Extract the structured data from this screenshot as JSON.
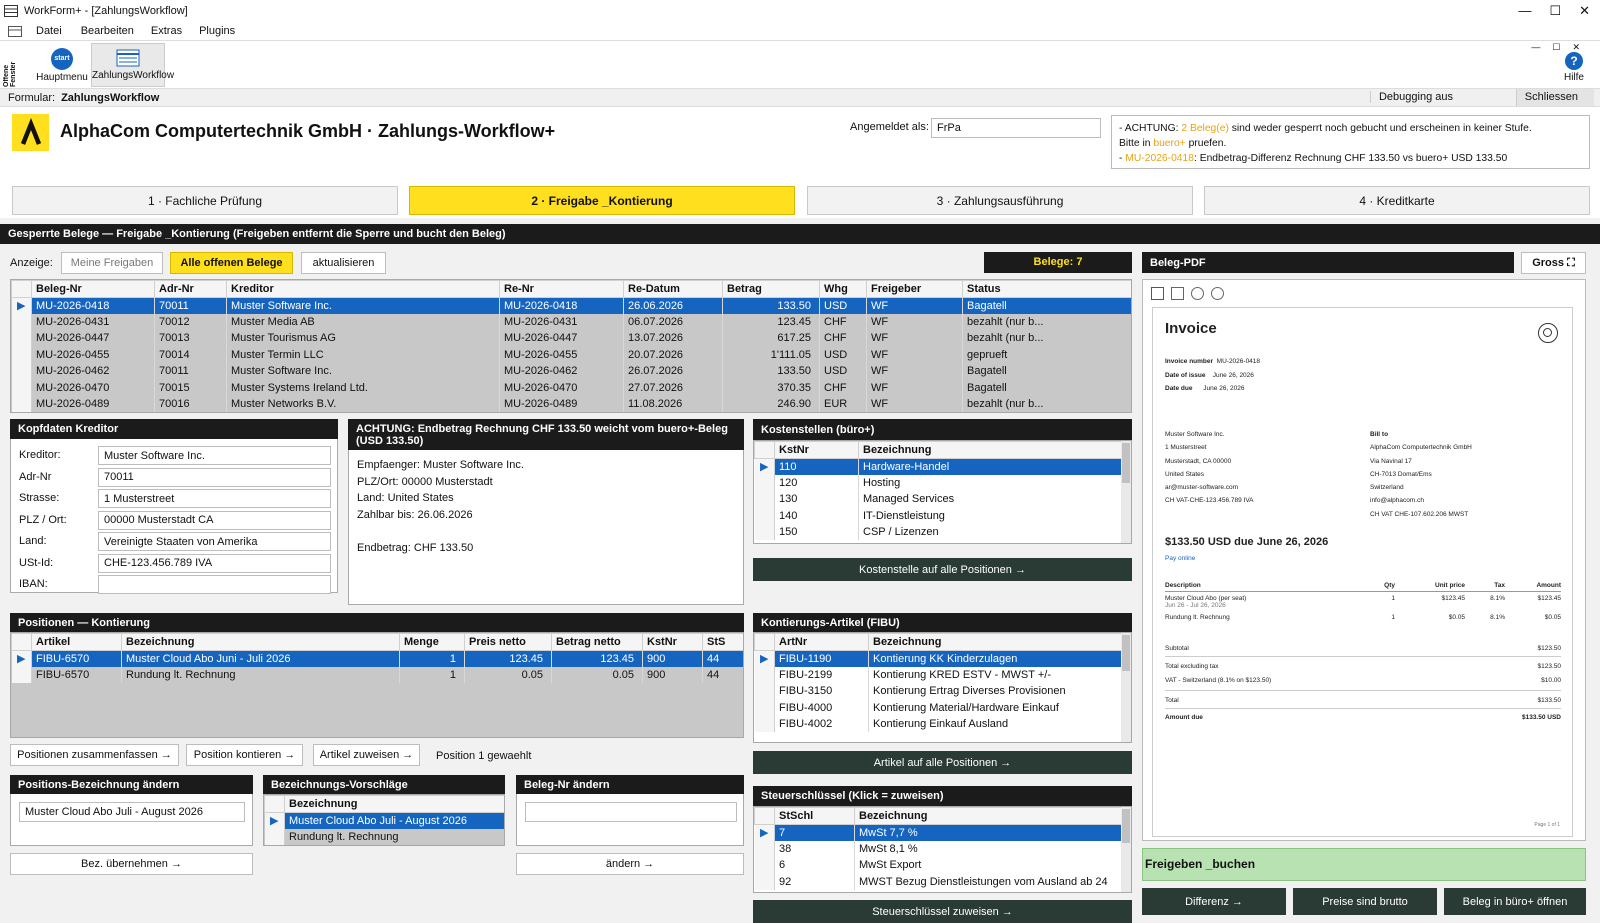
{
  "window": {
    "title": "WorkForm+ - [ZahlungsWorkflow]",
    "min": "—",
    "max": "☐",
    "close": "✕"
  },
  "menu": [
    "Datei",
    "Bearbeiten",
    "Extras",
    "Plugins"
  ],
  "toolbar": {
    "side_label_1": "Offene",
    "side_label_2": "Fenster",
    "start_icon_text": "start",
    "hauptmenu": "Hauptmenu",
    "zahlungsworkflow": "ZahlungsWorkflow",
    "help_label": "Hilfe",
    "help_icon": "?"
  },
  "formbar": {
    "label": "Formular:",
    "name": "ZahlungsWorkflow",
    "debug": "Debugging aus",
    "close": "Schliessen"
  },
  "header": {
    "title": "AlphaCom Computertechnik GmbH · Zahlungs-Workflow+",
    "login_label": "Angemeldet als:",
    "login_value": "FrPa",
    "warn1_a": "- ACHTUNG: ",
    "warn1_b": "2 Beleg(e)",
    "warn1_c": " sind weder gesperrt noch gebucht und erscheinen in keiner Stufe.",
    "warn2_a": "Bitte in ",
    "warn2_b": "buero+",
    "warn2_c": " pruefen.",
    "warn3_a": "- ",
    "warn3_b": "MU-2026-0418",
    "warn3_c": ": Endbetrag-Differenz Rechnung CHF 133.50 vs buero+ USD 133.50",
    "accent_color": "#e8a317"
  },
  "tabs": [
    "1 · Fachliche Prüfung",
    "2 · Freigabe _Kontierung",
    "3 · Zahlungsausführung",
    "4 · Kreditkarte"
  ],
  "section_title": "Gesperrte Belege — Freigabe _Kontierung (Freigeben entfernt die Sperre und bucht den Beleg)",
  "filter": {
    "label": "Anzeige:",
    "mine": "Meine Freigaben",
    "all": "Alle offenen Belege",
    "refresh": "aktualisieren",
    "count": "Belege: 7"
  },
  "belege": {
    "headers": [
      "Beleg-Nr",
      "Adr-Nr",
      "Kreditor",
      "Re-Nr",
      "Re-Datum",
      "Betrag",
      "Whg",
      "Freigeber",
      "Status"
    ],
    "rows": [
      [
        "MU-2026-0418",
        "70011",
        "Muster Software Inc.",
        "MU-2026-0418",
        "26.06.2026",
        "133.50",
        "USD",
        "WF",
        "Bagatell"
      ],
      [
        "MU-2026-0431",
        "70012",
        "Muster Media AB",
        "MU-2026-0431",
        "06.07.2026",
        "123.45",
        "CHF",
        "WF",
        "bezahlt (nur b..."
      ],
      [
        "MU-2026-0447",
        "70013",
        "Muster Tourismus AG",
        "MU-2026-0447",
        "13.07.2026",
        "617.25",
        "CHF",
        "WF",
        "bezahlt (nur b..."
      ],
      [
        "MU-2026-0455",
        "70014",
        "Muster Termin LLC",
        "MU-2026-0455",
        "20.07.2026",
        "1'111.05",
        "USD",
        "WF",
        "geprueft"
      ],
      [
        "MU-2026-0462",
        "70011",
        "Muster Software Inc.",
        "MU-2026-0462",
        "26.07.2026",
        "133.50",
        "USD",
        "WF",
        "Bagatell"
      ],
      [
        "MU-2026-0470",
        "70015",
        "Muster Systems Ireland Ltd.",
        "MU-2026-0470",
        "27.07.2026",
        "370.35",
        "CHF",
        "WF",
        "Bagatell"
      ],
      [
        "MU-2026-0489",
        "70016",
        "Muster Networks B.V.",
        "MU-2026-0489",
        "11.08.2026",
        "246.90",
        "EUR",
        "WF",
        "bezahlt (nur b..."
      ]
    ]
  },
  "kopf": {
    "title": "Kopfdaten Kreditor",
    "labels": [
      "Kreditor:",
      "Adr-Nr",
      "Strasse:",
      "PLZ / Ort:",
      "Land:",
      "USt-Id:",
      "IBAN:"
    ],
    "values": [
      "Muster Software Inc.",
      "70011",
      "1 Musterstreet",
      "00000 Musterstadt CA",
      "Vereinigte Staaten von Amerika",
      "CHE-123.456.789 IVA",
      ""
    ]
  },
  "achtung": {
    "title": "ACHTUNG: Endbetrag Rechnung CHF 133.50 weicht vom buero+-Beleg (USD 133.50)",
    "lines": [
      "Empfaenger: Muster Software Inc.",
      "PLZ/Ort: 00000 Musterstadt",
      "Land: United States",
      "Zahlbar bis: 26.06.2026",
      "",
      "Endbetrag: CHF 133.50"
    ]
  },
  "kostenstellen": {
    "title": "Kostenstellen (büro+)",
    "headers": [
      "KstNr",
      "Bezeichnung"
    ],
    "rows": [
      [
        "110",
        "Hardware-Handel"
      ],
      [
        "120",
        "Hosting"
      ],
      [
        "130",
        "Managed Services"
      ],
      [
        "140",
        "IT-Dienstleistung"
      ],
      [
        "150",
        "CSP / Lizenzen"
      ]
    ],
    "button": "Kostenstelle auf alle Positionen →"
  },
  "positionen": {
    "title": "Positionen — Kontierung",
    "headers": [
      "Artikel",
      "Bezeichnung",
      "Menge",
      "Preis netto",
      "Betrag netto",
      "KstNr",
      "StS"
    ],
    "rows": [
      [
        "FIBU-6570",
        "Muster Cloud Abo Juni - Juli 2026",
        "1",
        "123.45",
        "123.45",
        "900",
        "44"
      ],
      [
        "FIBU-6570",
        "Rundung lt. Rechnung",
        "1",
        "0.05",
        "0.05",
        "900",
        "44"
      ]
    ],
    "btn_merge": "Positionen zusammenfassen →",
    "btn_kont": "Position kontieren →",
    "btn_artikel": "Artikel zuweisen →",
    "status": "Position 1 gewaehlt"
  },
  "kontierung": {
    "title": "Kontierungs-Artikel (FIBU)",
    "headers": [
      "ArtNr",
      "Bezeichnung"
    ],
    "rows": [
      [
        "FIBU-1190",
        "Kontierung KK Kinderzulagen"
      ],
      [
        "FIBU-2199",
        "Kontierung KRED ESTV - MWST +/-"
      ],
      [
        "FIBU-3150",
        "Kontierung Ertrag Diverses Provisionen"
      ],
      [
        "FIBU-4000",
        "Kontierung Material/Hardware Einkauf"
      ],
      [
        "FIBU-4002",
        "Kontierung Einkauf Ausland"
      ]
    ],
    "button": "Artikel auf alle Positionen →"
  },
  "posbez": {
    "title": "Positions-Bezeichnung ändern",
    "value": "Muster Cloud Abo Juli - August 2026",
    "button": "Bez. übernehmen →"
  },
  "vorschlaege": {
    "title": "Bezeichnungs-Vorschläge",
    "header": "Bezeichnung",
    "rows": [
      "Muster Cloud Abo Juli - August 2026",
      "Rundung lt. Rechnung"
    ]
  },
  "belegnr": {
    "title": "Beleg-Nr ändern",
    "value": "",
    "button": "ändern →"
  },
  "steuer": {
    "title": "Steuerschlüssel (Klick = zuweisen)",
    "headers": [
      "StSchl",
      "Bezeichnung"
    ],
    "rows": [
      [
        "7",
        "MwSt 7,7 %"
      ],
      [
        "38",
        "MwSt 8,1 %"
      ],
      [
        "6",
        "MwSt Export"
      ],
      [
        "92",
        "MWST Bezug Dienstleistungen vom Ausland ab 24"
      ]
    ],
    "button": "Steuerschlüssel zuweisen →"
  },
  "pdf": {
    "title": "Beleg-PDF",
    "gross": "Gross ⛶",
    "invoice_title": "Invoice",
    "inv_num_lbl": "Invoice number",
    "inv_num": "MU-2026-0418",
    "issue_lbl": "Date of issue",
    "issue": "June 26, 2026",
    "due_lbl": "Date due",
    "due": "June 26, 2026",
    "from": [
      "Muster Software Inc.",
      "1 Musterstreet",
      "Musterstadt, CA 00000",
      "United States",
      "ar@muster-software.com",
      "CH VAT-CHE-123.456.789 IVA"
    ],
    "bill_to_lbl": "Bill to",
    "bill_to": [
      "AlphaCom Computertechnik GmbH",
      "Via Navinal 17",
      "CH-7013 Domat/Ems",
      "Switzerland",
      "info@alphacom.ch",
      "CH VAT CHE-107.602.206 MWST"
    ],
    "amount_due_title": "$133.50 USD due June 26, 2026",
    "pay_online": "Pay online",
    "table_headers": [
      "Description",
      "Qty",
      "Unit price",
      "Tax",
      "Amount"
    ],
    "items": [
      {
        "desc": "Muster Cloud Abo (per seat)",
        "sub": "Jun 26 - Jul 26, 2026",
        "qty": "1",
        "price": "$123.45",
        "tax": "8.1%",
        "amount": "$123.45"
      },
      {
        "desc": "Rundung lt. Rechnung",
        "sub": "",
        "qty": "1",
        "price": "$0.05",
        "tax": "8.1%",
        "amount": "$0.05"
      }
    ],
    "subtotal_lbl": "Subtotal",
    "subtotal": "$123.50",
    "total_ex_lbl": "Total excluding tax",
    "total_ex": "$123.50",
    "vat_lbl": "VAT - Switzerland (8.1% on $123.50)",
    "vat": "$10.00",
    "total_lbl": "Total",
    "total": "$133.50",
    "amount_due_lbl": "Amount due",
    "amount_due": "$133.50 USD",
    "page": "Page 1 of 1"
  },
  "actions": {
    "freigeben": "Freigeben _buchen",
    "differenz": "Differenz →",
    "brutto": "Preise sind brutto",
    "oeffnen": "Beleg in büro+ öffnen"
  }
}
